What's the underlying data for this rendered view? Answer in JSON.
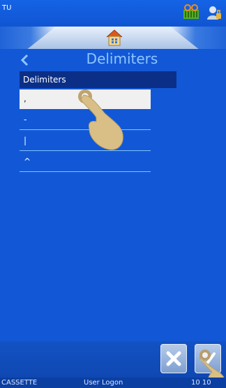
{
  "header": {
    "app_title": "TU",
    "cassette_icon": "cassette-ribbon-icon",
    "user_icon": "user-icon"
  },
  "home": {
    "icon": "home-icon"
  },
  "page": {
    "title": "Delimiters",
    "back_icon": "chevron-left-icon"
  },
  "list": {
    "header": "Delimiters",
    "items": [
      {
        "label": ",",
        "selected": true
      },
      {
        "label": "-",
        "selected": false
      },
      {
        "label": "|",
        "selected": false
      },
      {
        "label": "^",
        "selected": false
      }
    ]
  },
  "actions": {
    "cancel_icon": "close-icon",
    "confirm_icon": "check-icon"
  },
  "status": {
    "left": "CASSETTE",
    "middle": "User Logon",
    "right": "10 10"
  },
  "colors": {
    "accent": "#1258d6",
    "title_text": "#8fc6ff",
    "list_header_bg": "#0b2f86"
  }
}
